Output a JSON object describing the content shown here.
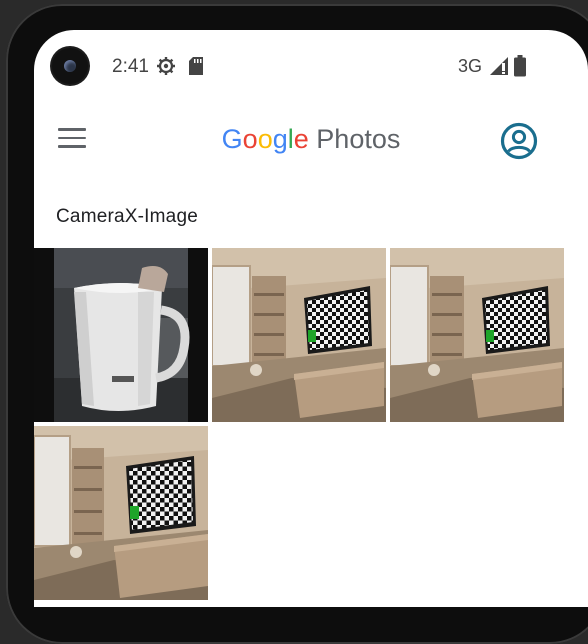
{
  "status_bar": {
    "time": "2:41",
    "network": "3G",
    "icons": [
      "settings-gear-icon",
      "sd-card-icon",
      "signal-icon",
      "battery-icon"
    ]
  },
  "app_bar": {
    "brand_google": [
      "G",
      "o",
      "o",
      "g",
      "l",
      "e"
    ],
    "brand_product": "Photos",
    "icons": [
      "hamburger-menu-icon",
      "account-circle-icon"
    ]
  },
  "album": {
    "title": "CameraX-Image",
    "photos": [
      {
        "subject": "white-mug"
      },
      {
        "subject": "room-tv-checkerboard"
      },
      {
        "subject": "room-tv-checkerboard"
      },
      {
        "subject": "room-tv-checkerboard"
      }
    ]
  },
  "colors": {
    "google_blue": "#4285f4",
    "google_red": "#ea4335",
    "google_yellow": "#fbbc05",
    "google_green": "#34a853",
    "account_icon": "#1a6e8e"
  }
}
